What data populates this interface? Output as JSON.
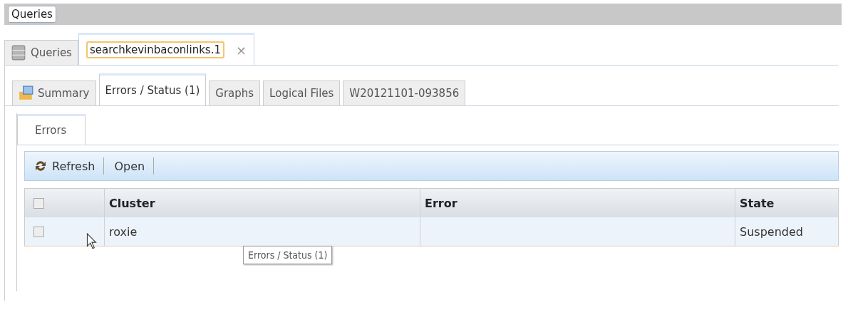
{
  "header": {
    "title": "Queries"
  },
  "outer_tabs": [
    {
      "label": "Queries",
      "kind": "icon",
      "selected": false
    },
    {
      "label": "searchkevinbaconlinks.1",
      "kind": "closable",
      "close": "×",
      "selected": true
    }
  ],
  "inner_tabs": [
    {
      "label": "Summary",
      "kind": "icon",
      "selected": false
    },
    {
      "label": "Errors / Status (1)",
      "kind": "text",
      "selected": true
    },
    {
      "label": "Graphs",
      "kind": "text",
      "selected": false
    },
    {
      "label": "Logical Files",
      "kind": "text",
      "selected": false
    },
    {
      "label": "W20121101-093856",
      "kind": "text",
      "selected": false
    }
  ],
  "sub_tabs": [
    {
      "label": "Errors",
      "selected": true
    }
  ],
  "toolbar": [
    {
      "label": "Refresh",
      "kind": "icon"
    },
    {
      "label": "Open",
      "kind": "text"
    }
  ],
  "table": {
    "header_checked": false,
    "columns": [
      "Cluster",
      "Error",
      "State"
    ],
    "rows": [
      {
        "checked": false,
        "cells": [
          "roxie",
          "",
          "Suspended"
        ]
      }
    ]
  },
  "tooltip": "Errors / Status (1)"
}
